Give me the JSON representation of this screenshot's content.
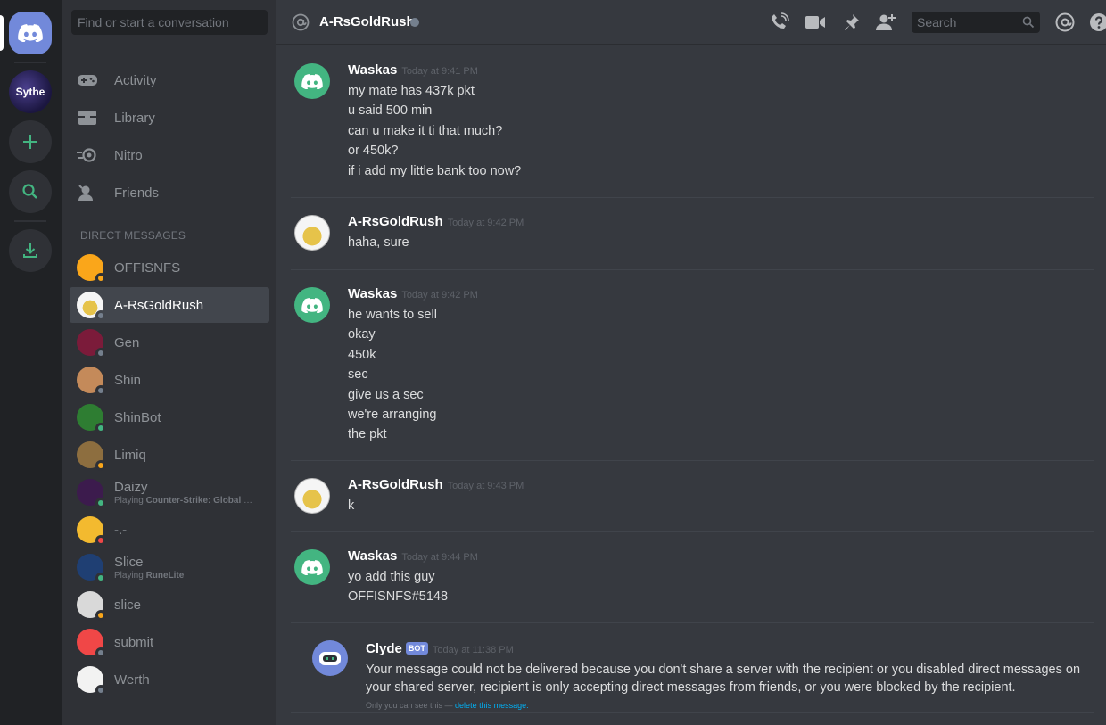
{
  "search_conversation_placeholder": "Find or start a conversation",
  "guild_rail": {
    "sythe_label": "Sythe"
  },
  "nav": [
    {
      "label": "Activity"
    },
    {
      "label": "Library"
    },
    {
      "label": "Nitro"
    },
    {
      "label": "Friends"
    }
  ],
  "dm_header": "DIRECT MESSAGES",
  "dms": [
    {
      "name": "OFFISNFS",
      "status": "idle",
      "avatar_color": "#faa61a"
    },
    {
      "name": "A-RsGoldRush",
      "status": "offline",
      "selected": true
    },
    {
      "name": "Gen",
      "status": "offline",
      "avatar_color": "#7b1b3a"
    },
    {
      "name": "Shin",
      "status": "offline",
      "avatar_color": "#c48a5a"
    },
    {
      "name": "ShinBot",
      "status": "online",
      "avatar_color": "#2e7d32"
    },
    {
      "name": "Limiq",
      "status": "idle",
      "avatar_color": "#8d6e3f"
    },
    {
      "name": "Daizy",
      "status": "online",
      "activity_prefix": "Playing ",
      "activity_name": "Counter-Strike: Global Offe...",
      "avatar_color": "#3c1b4d"
    },
    {
      "name": "-.-",
      "status": "dnd",
      "avatar_color": "#f3ba2f"
    },
    {
      "name": "Slice",
      "status": "online",
      "activity_prefix": "Playing ",
      "activity_name": "RuneLite",
      "avatar_color": "#1f3f73"
    },
    {
      "name": "slice",
      "status": "idle",
      "avatar_color": "#d9d9d9"
    },
    {
      "name": "submit",
      "status": "offline",
      "avatar_color": "#f04747"
    },
    {
      "name": "Werth",
      "status": "offline",
      "avatar_color": "#f2f2f2"
    }
  ],
  "status_colors": {
    "online": "#43b581",
    "idle": "#faa61a",
    "dnd": "#f04747",
    "offline": "#747f8d"
  },
  "topbar": {
    "channel_name": "A-RsGoldRush",
    "search_placeholder": "Search"
  },
  "messages": [
    {
      "author": "Waskas",
      "timestamp": "Today at 9:41 PM",
      "avatar": "discord",
      "lines": [
        "my mate has 437k pkt",
        "u said 500 min",
        "can u make it ti that much?",
        "or 450k?",
        "if i add my little bank too now?"
      ]
    },
    {
      "author": "A-RsGoldRush",
      "timestamp": "Today at 9:42 PM",
      "avatar": "goldrush",
      "lines": [
        "haha, sure"
      ]
    },
    {
      "author": "Waskas",
      "timestamp": "Today at 9:42 PM",
      "avatar": "discord",
      "lines": [
        "he wants to sell",
        "okay",
        "450k",
        "sec",
        "give us a sec",
        "we're arranging",
        "the pkt"
      ]
    },
    {
      "author": "A-RsGoldRush",
      "timestamp": "Today at 9:43 PM",
      "avatar": "goldrush",
      "lines": [
        "k"
      ]
    },
    {
      "author": "Waskas",
      "timestamp": "Today at 9:44 PM",
      "avatar": "discord",
      "lines": [
        "yo add this guy",
        "OFFISNFS#5148"
      ]
    }
  ],
  "clyde": {
    "author": "Clyde",
    "tag": "BOT",
    "timestamp": "Today at 11:38 PM",
    "text": "Your message could not be delivered because you don't share a server with the recipient or you disabled direct messages on your shared server, recipient is only accepting direct messages from friends, or you were blocked by the recipient.",
    "only_you": "Only you can see this — ",
    "delete_link": "delete this message."
  },
  "colors": {
    "accent": "#7289da",
    "green": "#43b581"
  }
}
